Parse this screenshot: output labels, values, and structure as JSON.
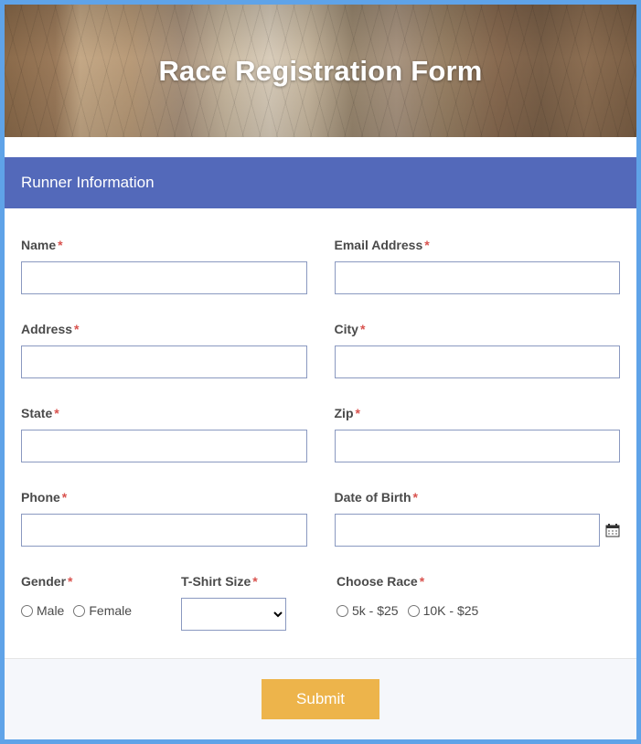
{
  "hero": {
    "title": "Race Registration Form"
  },
  "section": {
    "header": "Runner Information"
  },
  "labels": {
    "name": "Name",
    "email": "Email Address",
    "address": "Address",
    "city": "City",
    "state": "State",
    "zip": "Zip",
    "phone": "Phone",
    "dob": "Date of Birth",
    "gender": "Gender",
    "tshirt": "T-Shirt Size",
    "race": "Choose Race"
  },
  "required_marker": "*",
  "gender_options": {
    "male": "Male",
    "female": "Female"
  },
  "race_options": {
    "five_k": "5k - $25",
    "ten_k": "10K - $25"
  },
  "buttons": {
    "submit": "Submit"
  },
  "values": {
    "name": "",
    "email": "",
    "address": "",
    "city": "",
    "state": "",
    "zip": "",
    "phone": "",
    "dob": "",
    "tshirt": ""
  }
}
